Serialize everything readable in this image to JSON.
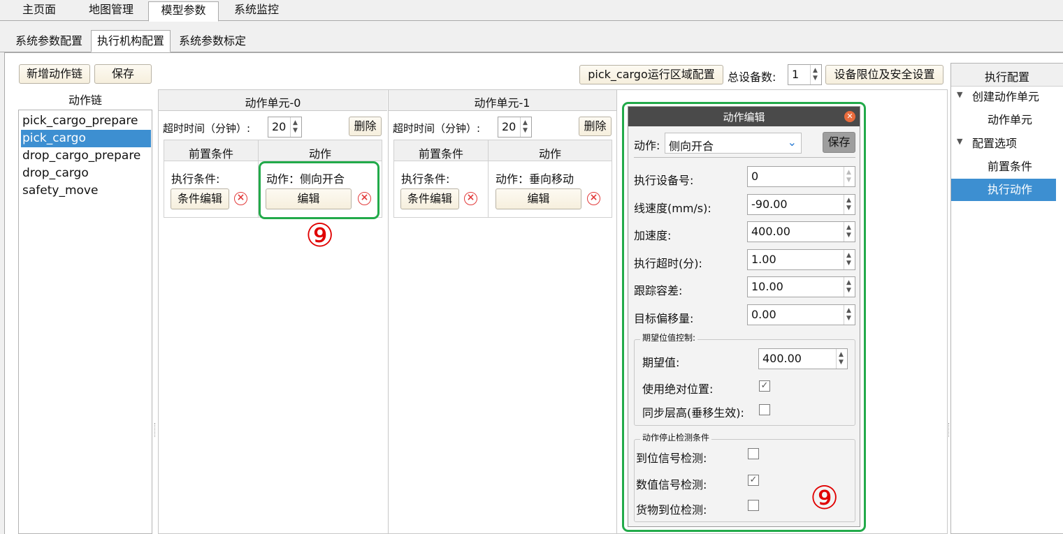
{
  "top_tabs": [
    "主页面",
    "地图管理",
    "模型参数",
    "系统监控"
  ],
  "sub_tabs": [
    "系统参数配置",
    "执行机构配置",
    "系统参数标定"
  ],
  "toolbar": {
    "add_chain_label": "新增动作链",
    "save_label": "保存",
    "pick_region_label": "pick_cargo运行区域配置",
    "total_devices_label": "总设备数:",
    "total_devices_value": "1",
    "limit_safety_label": "设备限位及安全设置"
  },
  "chain_list": {
    "title": "动作链",
    "items": [
      "pick_cargo_prepare",
      "pick_cargo",
      "drop_cargo_prepare",
      "drop_cargo",
      "safety_move"
    ],
    "selected": "pick_cargo"
  },
  "units": [
    {
      "title": "动作单元-0",
      "timeout_label": "超时时间（分钟）:",
      "timeout_value": "20",
      "delete_label": "删除",
      "col_pre": "前置条件",
      "col_action": "动作",
      "exec_cond_label": "执行条件:",
      "cond_edit_label": "条件编辑",
      "action_text": "动作：侧向开合",
      "edit_label": "编辑"
    },
    {
      "title": "动作单元-1",
      "timeout_label": "超时时间（分钟）:",
      "timeout_value": "20",
      "delete_label": "删除",
      "col_pre": "前置条件",
      "col_action": "动作",
      "exec_cond_label": "执行条件:",
      "cond_edit_label": "条件编辑",
      "action_text": "动作：垂向移动",
      "edit_label": "编辑"
    }
  ],
  "dialog": {
    "title": "动作编辑",
    "action_label": "动作:",
    "action_value": "侧向开合",
    "save_label": "保存",
    "fields": [
      {
        "label": "执行设备号:",
        "value": "0"
      },
      {
        "label": "线速度(mm/s):",
        "value": "-90.00"
      },
      {
        "label": "加速度:",
        "value": "400.00"
      },
      {
        "label": "执行超时(分):",
        "value": "1.00"
      },
      {
        "label": "跟踪容差:",
        "value": "10.00"
      },
      {
        "label": "目标偏移量:",
        "value": "0.00"
      }
    ],
    "expect_group": {
      "title": "期望位值控制:",
      "expect_label": "期望值:",
      "expect_value": "400.00",
      "abs_label": "使用绝对位置:",
      "abs_checked": true,
      "sync_label": "同步层高(垂移生效):",
      "sync_checked": false
    },
    "stop_group": {
      "title": "动作停止检测条件",
      "items": [
        {
          "label": "到位信号检测:",
          "checked": false
        },
        {
          "label": "数值信号检测:",
          "checked": true
        },
        {
          "label": "货物到位检测:",
          "checked": false
        }
      ]
    }
  },
  "tree": {
    "title": "执行配置",
    "nodes": [
      {
        "label": "创建动作单元",
        "level": 0
      },
      {
        "label": "动作单元",
        "level": 1
      },
      {
        "label": "配置选项",
        "level": 0
      },
      {
        "label": "前置条件",
        "level": 1
      },
      {
        "label": "执行动作",
        "level": 1,
        "selected": true
      }
    ]
  },
  "annotations": [
    "⑨",
    "⑨"
  ],
  "colors": {
    "selection": "#3d8fd1",
    "highlight_box": "#22aa4a",
    "annotation": "#e00000",
    "delete_icon": "#e23b3b",
    "dialog_title": "#4a4a4a"
  }
}
